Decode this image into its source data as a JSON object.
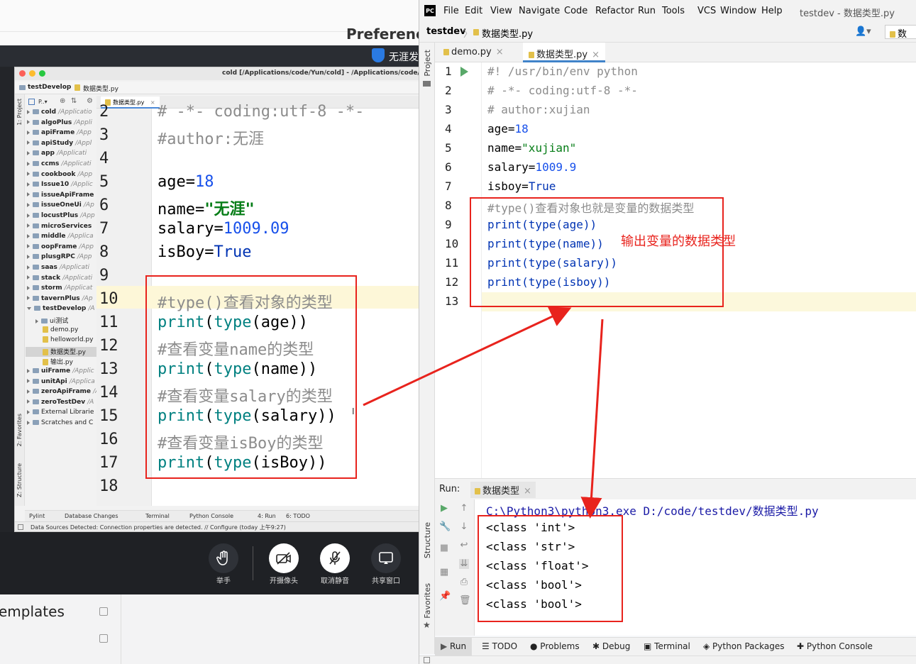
{
  "background": {
    "preferences_title": "Preferenc",
    "bar_label": "无涯发",
    "templates_label": "emplates",
    "meeting_buttons": [
      {
        "label": "举手",
        "icon": "hand-icon"
      },
      {
        "label": "开摄像头",
        "icon": "camera-off-icon"
      },
      {
        "label": "取消静音",
        "icon": "mic-off-icon"
      },
      {
        "label": "共享窗口",
        "icon": "share-screen-icon"
      }
    ]
  },
  "mac_ide": {
    "title": "cold [/Applications/code/Yun/cold] - /Applications/code/Yu",
    "breadcrumb": [
      "testDevelop",
      "数据类型.py"
    ],
    "project_label": "P..▾",
    "tab": "数据类型.py",
    "tree": [
      {
        "name": "cold",
        "path": "/Applicatio"
      },
      {
        "name": "algoPlus",
        "path": "/Appli"
      },
      {
        "name": "apiFrame",
        "path": "/App"
      },
      {
        "name": "apiStudy",
        "path": "/Appl"
      },
      {
        "name": "app",
        "path": "/Applicati"
      },
      {
        "name": "ccms",
        "path": "/Applicati"
      },
      {
        "name": "cookbook",
        "path": "/App"
      },
      {
        "name": "Issue10",
        "path": "/Applic"
      },
      {
        "name": "issueApiFrame",
        "path": ""
      },
      {
        "name": "issueOneUi",
        "path": "/Ap"
      },
      {
        "name": "locustPlus",
        "path": "/App"
      },
      {
        "name": "microServices",
        "path": ""
      },
      {
        "name": "middle",
        "path": "/Applica"
      },
      {
        "name": "oopFrame",
        "path": "/App"
      },
      {
        "name": "plusgRPC",
        "path": "/App"
      },
      {
        "name": "saas",
        "path": "/Applicati"
      },
      {
        "name": "stack",
        "path": "/Applicati"
      },
      {
        "name": "storm",
        "path": "/Applicat"
      },
      {
        "name": "tavernPlus",
        "path": "/Ap"
      },
      {
        "name": "testDevelop",
        "path": "/A"
      }
    ],
    "tree_children": [
      "ui测试",
      "demo.py",
      "helloworld.py",
      "数据类型.py",
      "输出.py"
    ],
    "tree_after": [
      {
        "name": "uiFrame",
        "path": "/Applic"
      },
      {
        "name": "unitApi",
        "path": "/Applica"
      },
      {
        "name": "zeroApiFrame",
        "path": "/A"
      },
      {
        "name": "zeroTestDev",
        "path": "/A"
      }
    ],
    "tree_extra": [
      "External Librarie",
      "Scratches and C"
    ],
    "line_numbers": [
      "2",
      "3",
      "4",
      "5",
      "6",
      "7",
      "8",
      "9",
      "10",
      "11",
      "12",
      "13",
      "14",
      "15",
      "16",
      "17",
      "18"
    ],
    "code": {
      "l2": "# -*- coding:utf-8 -*-",
      "l3": "#author:无涯",
      "l5_var": "age",
      "l5_val": "18",
      "l6_var": "name",
      "l6_val": "\"无涯\"",
      "l7_var": "salary",
      "l7_val": "1009.09",
      "l8_var": "isBoy",
      "l8_val": "True",
      "l10": "#type()查看对象的类型",
      "l11_arg": "age",
      "l12": "#查看变量name的类型",
      "l13_arg": "name",
      "l14": "#查看变量salary的类型",
      "l15_arg": "salary",
      "l16": "#查看变量isBoy的类型",
      "l17_arg": "isBoy",
      "print": "print",
      "type": "type"
    },
    "sidebar_labels": [
      "1: Project",
      "2: Favorites",
      "Z: Structure"
    ],
    "bottom_tabs": [
      "Pylint",
      "Database Changes",
      "Terminal",
      "Python Console",
      "4: Run",
      "6: TODO"
    ],
    "status": "Data Sources Detected: Connection properties are detected. // Configure (today 上午9:27)"
  },
  "pycharm": {
    "menu": [
      "File",
      "Edit",
      "View",
      "Navigate",
      "Code",
      "Refactor",
      "Run",
      "Tools",
      "VCS",
      "Window",
      "Help"
    ],
    "title": "testdev - 数据类型.py",
    "breadcrumb_project": "testdev",
    "breadcrumb_file": "数据类型.py",
    "run_config": "数",
    "tabs": [
      "demo.py",
      "数据类型.py"
    ],
    "side_labels": [
      "Project",
      "Structure",
      "Favorites"
    ],
    "line_numbers": [
      "1",
      "2",
      "3",
      "4",
      "5",
      "6",
      "7",
      "8",
      "9",
      "10",
      "11",
      "12",
      "13"
    ],
    "code": {
      "l1": "#! /usr/bin/env python",
      "l2": "# -*- coding:utf-8 -*-",
      "l3": "# author:xujian",
      "l4_var": "age",
      "l4_val": "18",
      "l5_var": "name",
      "l5_val": "\"xujian\"",
      "l6_var": "salary",
      "l6_val": "1009.9",
      "l7_var": "isboy",
      "l7_val": "True",
      "l8": "#type()查看对象也就是变量的数据类型",
      "l9": "print(type(age))",
      "l10": "print(type(name))",
      "l11": "print(type(salary))",
      "l12": "print(type(isboy))"
    },
    "run_label": "Run:",
    "run_tab": "数据类型",
    "console": [
      "C:\\Python3\\python3.exe D:/code/testdev/数据类型.py",
      "<class 'int'>",
      "<class 'str'>",
      "<class 'float'>",
      "<class 'bool'>",
      "<class 'bool'>"
    ],
    "bottom_tabs": [
      "Run",
      "TODO",
      "Problems",
      "Debug",
      "Terminal",
      "Python Packages",
      "Python Console"
    ]
  },
  "annotation": {
    "text": "输出变量的数据类型",
    "color": "#e8231d"
  }
}
